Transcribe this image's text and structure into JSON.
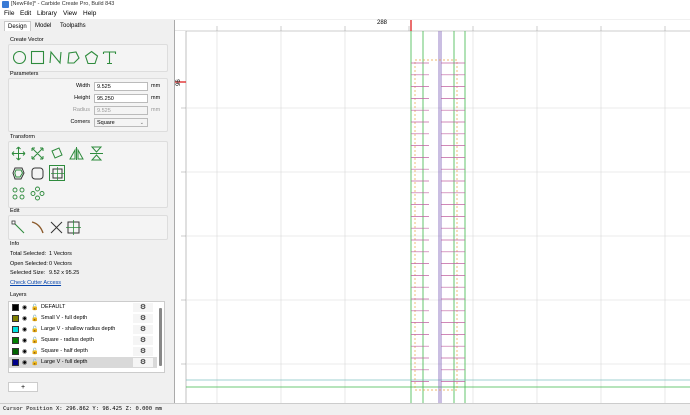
{
  "window": {
    "title": "[NewFile]* - Carbide Create Pro, Build 843"
  },
  "menu": [
    "File",
    "Edit",
    "Library",
    "View",
    "Help"
  ],
  "tabs": [
    "Design",
    "Model",
    "Toolpaths"
  ],
  "create_vector": {
    "title": "Create Vector",
    "tools": [
      "circle-icon",
      "rectangle-icon",
      "curve-icon",
      "polygon-icon",
      "pentagon-icon",
      "text-icon"
    ]
  },
  "parameters": {
    "title": "Parameters",
    "width_label": "Width",
    "width_value": "9.525",
    "height_label": "Height",
    "height_value": "95.250",
    "radius_label": "Radius",
    "radius_value": "9.525",
    "corners_label": "Corners",
    "corners_value": "Square",
    "unit": "mm"
  },
  "transform": {
    "title": "Transform"
  },
  "edit": {
    "title": "Edit"
  },
  "info": {
    "title": "Info",
    "total_label": "Total Selected:",
    "total_value": "1 Vectors",
    "open_label": "Open Selected:",
    "open_value": "0 Vectors",
    "size_label": "Selected Size:",
    "size_value": "9.52 x 95.25",
    "check_link": "Check Cutter Access"
  },
  "layers": {
    "title": "Layers",
    "items": [
      {
        "name": "DEFAULT",
        "color": "#000000"
      },
      {
        "name": "Small V - full depth",
        "color": "#808000"
      },
      {
        "name": "Large V - shallow radius depth",
        "color": "#00e0e0"
      },
      {
        "name": "Square - radius depth",
        "color": "#008000"
      },
      {
        "name": "Square - half depth",
        "color": "#006400"
      },
      {
        "name": "Large V - full depth",
        "color": "#00008b"
      }
    ],
    "add_label": "+"
  },
  "ruler": {
    "top_label": "288",
    "left_label": "96"
  },
  "status": {
    "text": "Cursor Position X: 296.862 Y: 98.425 Z: 0.000 mm"
  }
}
